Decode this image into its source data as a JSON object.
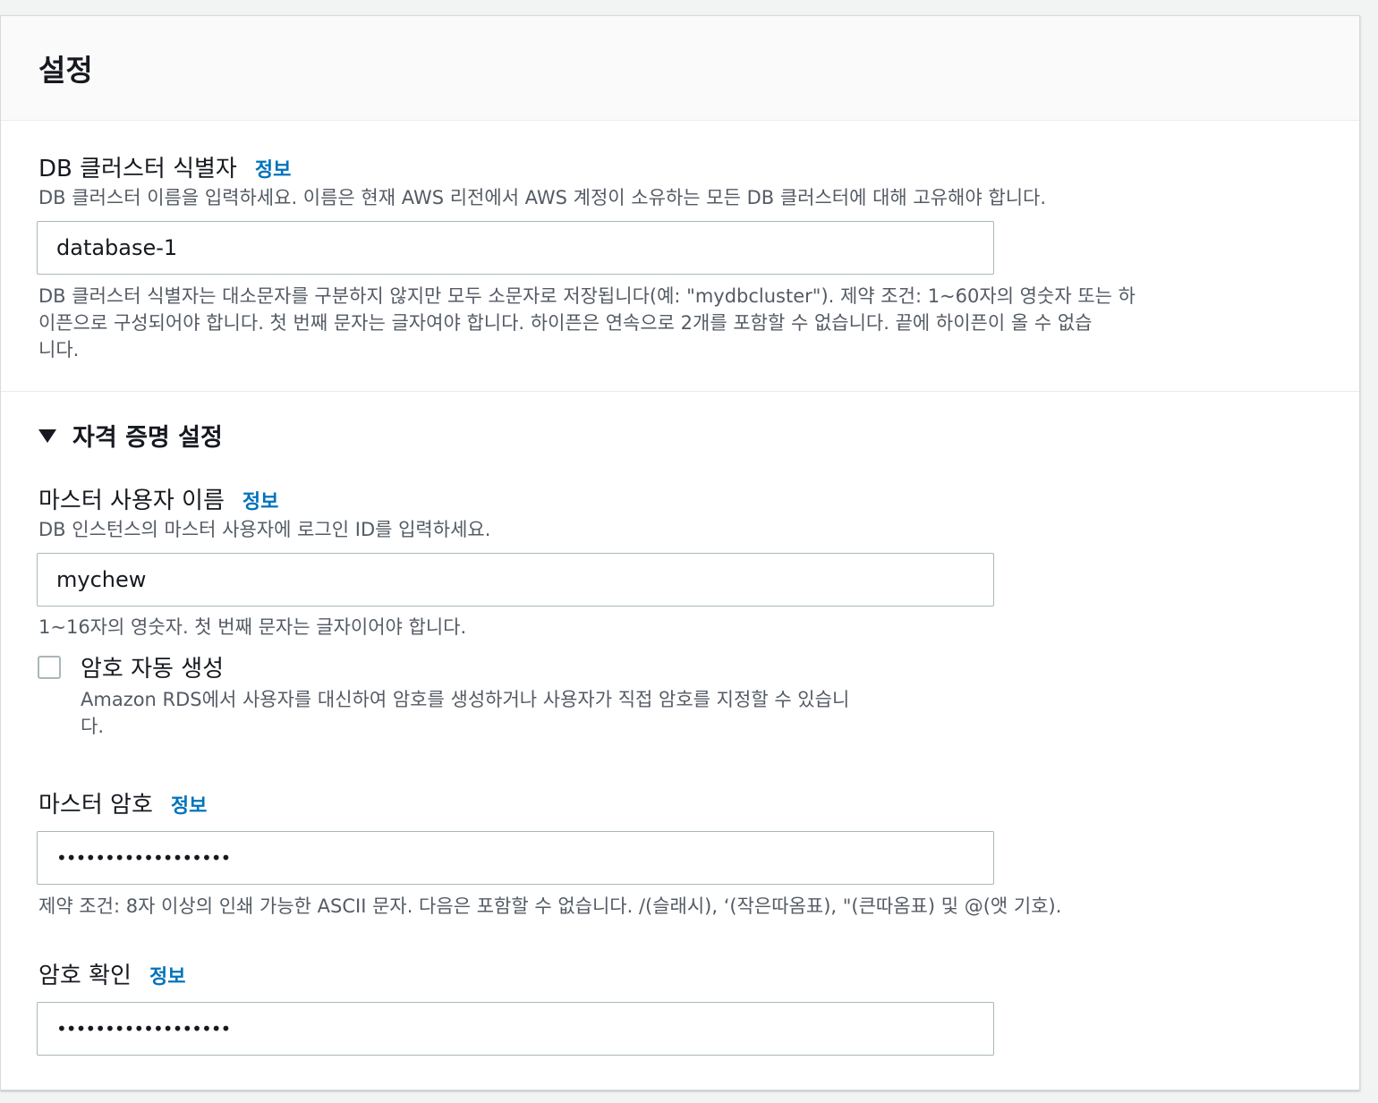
{
  "panel": {
    "title": "설정"
  },
  "cluster_identifier": {
    "label": "DB 클러스터 식별자",
    "info": "정보",
    "description": "DB 클러스터 이름을 입력하세요. 이름은 현재 AWS 리전에서 AWS 계정이 소유하는 모든 DB 클러스터에 대해 고유해야 합니다.",
    "value": "database-1",
    "constraint_line1": "DB 클러스터 식별자는 대소문자를 구분하지 않지만 모두 소문자로 저장됩니다(예: \"mydbcluster\"). 제약 조건: 1~60자의 영숫자 또는 하",
    "constraint_line2": "이픈으로 구성되어야 합니다. 첫 번째 문자는 글자여야 합니다. 하이픈은 연속으로 2개를 포함할 수 없습니다. 끝에 하이픈이 올 수 없습",
    "constraint_line3": "니다."
  },
  "credentials": {
    "section_title": "자격 증명 설정",
    "master_username": {
      "label": "마스터 사용자 이름",
      "info": "정보",
      "description": "DB 인스턴스의 마스터 사용자에 로그인 ID를 입력하세요.",
      "value": "mychew",
      "constraint": "1~16자의 영숫자. 첫 번째 문자는 글자이어야 합니다."
    },
    "auto_password": {
      "label": "암호 자동 생성",
      "description_line1": "Amazon RDS에서 사용자를 대신하여 암호를 생성하거나 사용자가 직접 암호를 지정할 수 있습니",
      "description_line2": "다.",
      "checked": false
    },
    "master_password": {
      "label": "마스터 암호",
      "info": "정보",
      "value": "••••••••••••••••••",
      "constraint": "제약 조건: 8자 이상의 인쇄 가능한 ASCII 문자. 다음은 포함할 수 없습니다. /(슬래시), ‘(작은따옴표), \"(큰따옴표) 및 @(앳 기호)."
    },
    "confirm_password": {
      "label": "암호 확인",
      "info": "정보",
      "value": "••••••••••••••••••"
    }
  },
  "colors": {
    "link": "#0073bb",
    "text": "#16191f",
    "secondary_text": "#545b64",
    "input_border": "#aab7b8"
  }
}
